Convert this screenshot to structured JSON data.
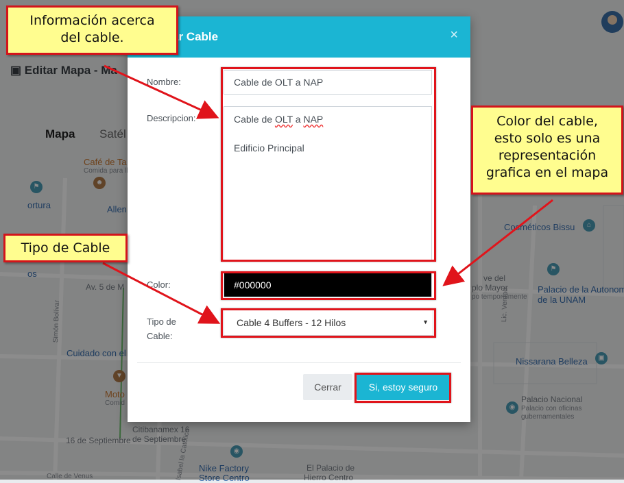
{
  "background": {
    "page_title": "Editar Mapa - Ma",
    "map_tabs": [
      "Mapa",
      "Satél"
    ],
    "map_labels": [
      "Café de Ta",
      "Comida para ll",
      "ortura",
      "Allen",
      "Av. 5 de M",
      "Cuidado con el",
      "Moto",
      "Comid",
      "16 de Septiembre",
      "Citibanamex 16",
      "de Septiembre",
      "Nike Factory",
      "Store Centro",
      "El Palacio de",
      "Hierro Centro",
      "Calle de Venus",
      "Cosméticos Bissu",
      "Palacio de la Autonom",
      "de la UNAM",
      "plo Mayor",
      "po temporalmente",
      "ve del",
      "Nissarana Belleza",
      "Palacio Nacional",
      "Palacio con oficinas",
      "gubernamentales",
      "Lic. Verdad",
      "Simón Bolívar",
      "Isabel la Católica",
      "os"
    ]
  },
  "modal": {
    "title": "rdar Cable",
    "close_icon": "×",
    "fields": {
      "name_label": "Nombre:",
      "name_value": "Cable de OLT a NAP",
      "desc_label": "Descripcion:",
      "desc_line1_prefix": "Cable de ",
      "desc_line1_word1": "OLT",
      "desc_line1_mid": " a ",
      "desc_line1_word2": "NAP",
      "desc_line2": "Edificio Principal",
      "color_label": "Color:",
      "color_value": "#000000",
      "type_label_1": "Tipo de",
      "type_label_2": "Cable:",
      "type_value": "Cable 4 Buffers - 12 Hilos"
    },
    "buttons": {
      "close": "Cerrar",
      "confirm": "Si, estoy seguro"
    }
  },
  "annotations": {
    "info_line1": "Información acerca",
    "info_line2": "del cable.",
    "color_line1": "Color del cable,",
    "color_line2": "esto solo es una",
    "color_line3": "representación",
    "color_line4": "grafica en el mapa",
    "type_callout": "Tipo de Cable"
  },
  "colors": {
    "header": "#1bb5d3",
    "highlight": "#e0141b",
    "callout_bg": "#fffd8f",
    "cable_color": "#000000"
  }
}
